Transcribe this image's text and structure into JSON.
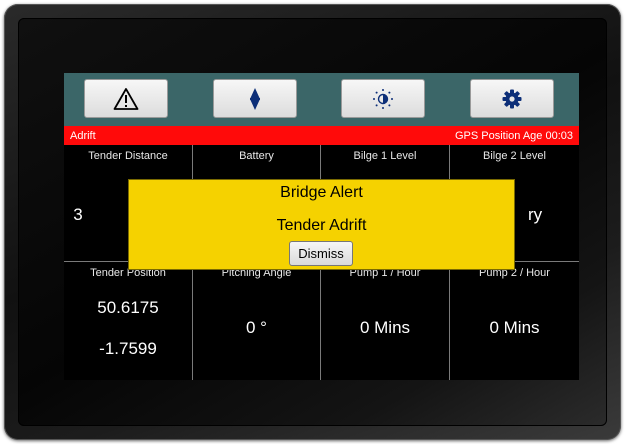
{
  "toolbar": {
    "buttons": [
      {
        "icon": "warning-icon"
      },
      {
        "icon": "compass-needle-icon"
      },
      {
        "icon": "brightness-icon"
      },
      {
        "icon": "gear-icon"
      }
    ]
  },
  "status": {
    "left": "Adrift",
    "right": "GPS Position Age  00:03"
  },
  "cells": {
    "tender_distance": {
      "label": "Tender Distance",
      "value": "3"
    },
    "battery": {
      "label": "Battery",
      "value": ""
    },
    "bilge1": {
      "label": "Bilge 1 Level",
      "value": ""
    },
    "bilge2": {
      "label": "Bilge 2 Level",
      "value": "ry"
    },
    "tender_position": {
      "label": "Tender Position",
      "lat": "50.6175",
      "lon": "-1.7599"
    },
    "pitching": {
      "label": "Pitching Angle",
      "value": "0 °"
    },
    "pump1": {
      "label": "Pump 1 / Hour",
      "value": "0 Mins"
    },
    "pump2": {
      "label": "Pump 2 / Hour",
      "value": "0 Mins"
    }
  },
  "alert": {
    "title": "Bridge Alert",
    "message": "Tender Adrift",
    "dismiss_label": "Dismiss"
  },
  "colors": {
    "toolbar": "#3b6668",
    "status_bar": "#ff0a0a",
    "alert": "#f5d200",
    "screen": "#000000"
  }
}
